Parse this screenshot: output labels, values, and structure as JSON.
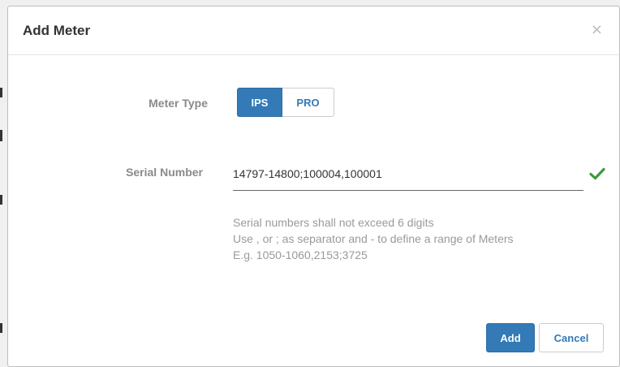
{
  "dialog": {
    "title": "Add Meter",
    "close_glyph": "×"
  },
  "form": {
    "meter_type_label": "Meter Type",
    "meter_type_options": [
      "IPS",
      "PRO"
    ],
    "meter_type_selected": "IPS",
    "serial_label": "Serial Number",
    "serial_value": "14797-14800;100004,100001",
    "serial_valid_icon": "check-icon",
    "help_lines": [
      "Serial numbers shall not exceed 6 digits",
      "Use , or ; as separator and - to define a range of Meters",
      "E.g. 1050-1060,2153;3725"
    ]
  },
  "footer": {
    "add_label": "Add",
    "cancel_label": "Cancel"
  },
  "colors": {
    "primary": "#337ab7",
    "valid_check": "#3c9a3c",
    "label_text": "#8a8a8a",
    "help_text": "#9a9a9a"
  }
}
